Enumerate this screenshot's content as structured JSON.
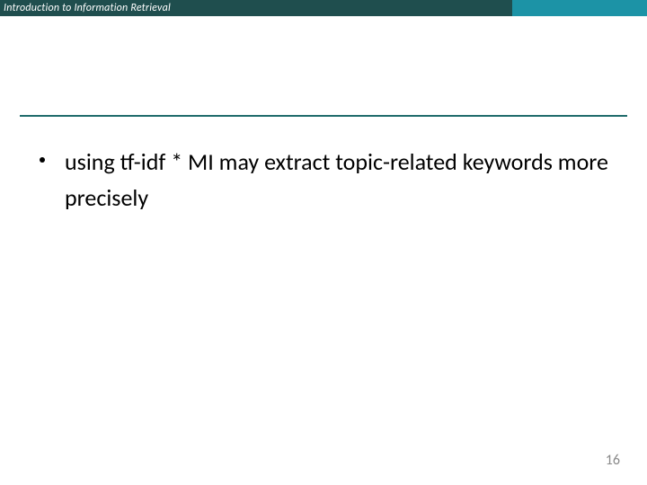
{
  "header": {
    "title": "Introduction to Information Retrieval"
  },
  "body": {
    "bullets": [
      "using tf-idf * MI may extract topic-related keywords more precisely"
    ]
  },
  "footer": {
    "page_number": "16"
  }
}
